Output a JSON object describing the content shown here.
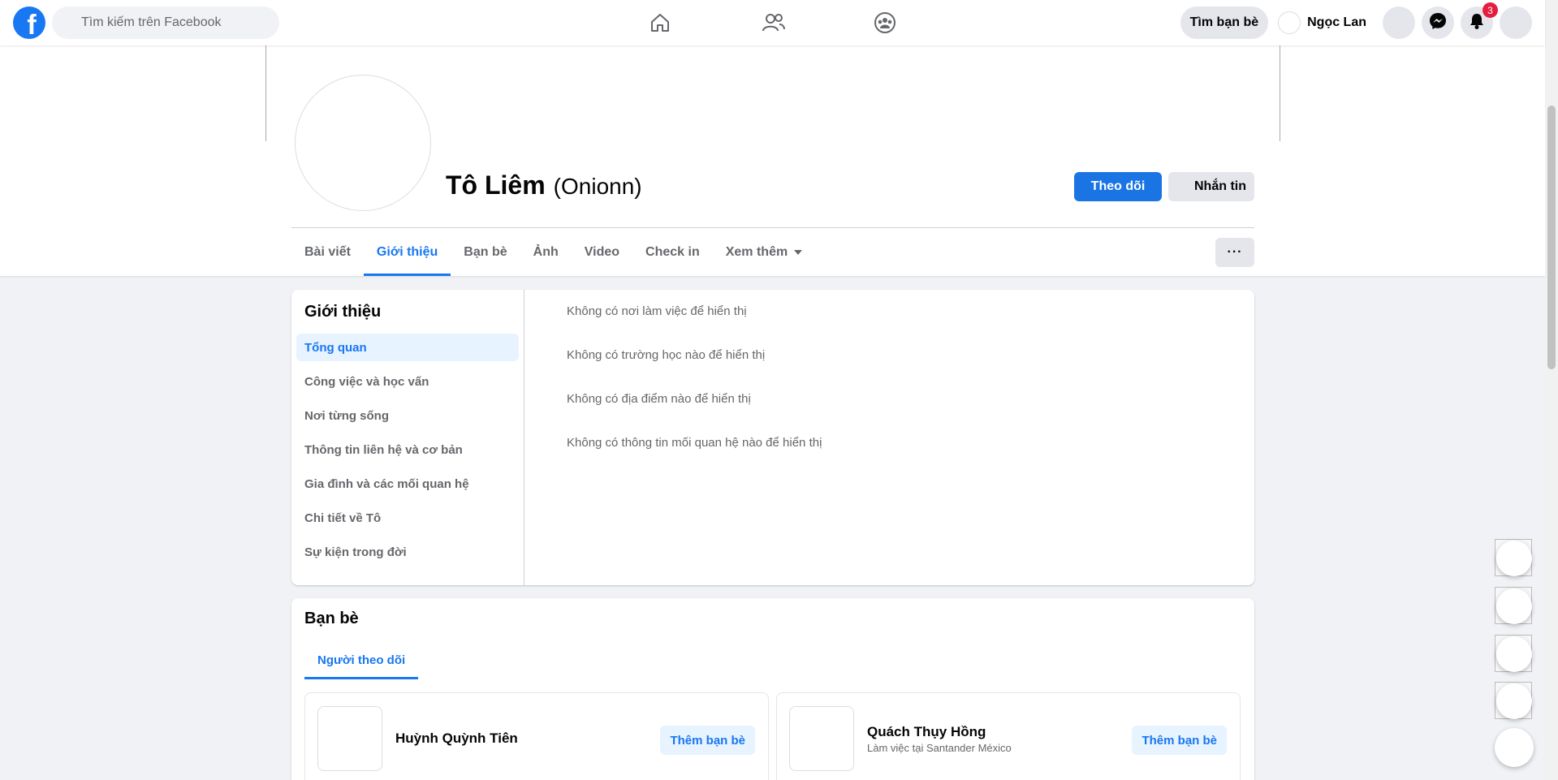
{
  "topbar": {
    "search_placeholder": "Tìm kiếm trên Facebook",
    "find_friends": "Tìm bạn bè",
    "user_name": "Ngọc Lan",
    "notification_count": "3"
  },
  "profile": {
    "name": "Tô Liêm",
    "alt_name": "(Onionn)",
    "follow_label": "Theo dõi",
    "message_label": "Nhắn tin",
    "more_label": "···"
  },
  "tabs": [
    {
      "label": "Bài viết"
    },
    {
      "label": "Giới thiệu",
      "active": true
    },
    {
      "label": "Bạn bè"
    },
    {
      "label": "Ảnh"
    },
    {
      "label": "Video"
    },
    {
      "label": "Check in"
    },
    {
      "label": "Xem thêm"
    }
  ],
  "about": {
    "title": "Giới thiệu",
    "menu": [
      {
        "label": "Tổng quan",
        "active": true
      },
      {
        "label": "Công việc và học vấn"
      },
      {
        "label": "Nơi từng sống"
      },
      {
        "label": "Thông tin liên hệ và cơ bản"
      },
      {
        "label": "Gia đình và các mối quan hệ"
      },
      {
        "label": "Chi tiết về Tô"
      },
      {
        "label": "Sự kiện trong đời"
      }
    ],
    "overview": [
      "Không có nơi làm việc để hiển thị",
      "Không có trường học nào để hiển thị",
      "Không có địa điểm nào để hiển thị",
      "Không có thông tin mối quan hệ nào để hiển thị"
    ]
  },
  "friends": {
    "title": "Bạn bè",
    "tab_label": "Người theo dõi",
    "list": [
      {
        "name": "Huỳnh Quỳnh Tiên",
        "subtitle": "",
        "action": "Thêm bạn bè"
      },
      {
        "name": "Quách Thụy Hồng",
        "subtitle": "Làm việc tại Santander México",
        "action": "Thêm bạn bè"
      }
    ]
  },
  "colors": {
    "brand": "#1877f2",
    "badge": "#e41e3f",
    "background": "#f0f2f5"
  },
  "icons": [
    "facebook-logo-icon",
    "search-icon",
    "home-icon",
    "friends-icon",
    "groups-icon",
    "messenger-icon",
    "bell-icon",
    "caret-down-icon"
  ]
}
